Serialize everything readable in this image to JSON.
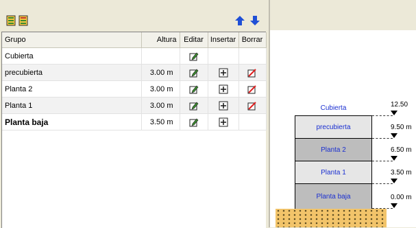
{
  "toolbar": {
    "icons": [
      "sheet-add-icon",
      "sheet-edit-icon",
      "arrow-up-icon",
      "arrow-down-icon"
    ]
  },
  "table": {
    "headers": {
      "grupo": "Grupo",
      "altura": "Altura",
      "editar": "Editar",
      "insertar": "Insertar",
      "borrar": "Borrar"
    },
    "rows": [
      {
        "grupo": "Cubierta",
        "altura": "",
        "edit": true,
        "insert": false,
        "delete": false
      },
      {
        "grupo": "precubierta",
        "altura": "3.00 m",
        "edit": true,
        "insert": true,
        "delete": true
      },
      {
        "grupo": "Planta 2",
        "altura": "3.00 m",
        "edit": true,
        "insert": true,
        "delete": true
      },
      {
        "grupo": "Planta 1",
        "altura": "3.00 m",
        "edit": true,
        "insert": true,
        "delete": true
      },
      {
        "grupo": "Planta baja",
        "altura": "3.50 m",
        "edit": true,
        "insert": true,
        "delete": false
      }
    ]
  },
  "diagram": {
    "levels": [
      {
        "name": "Cubierta",
        "elev": "12.50"
      },
      {
        "name": "precubierta",
        "elev": "9.50 m"
      },
      {
        "name": "Planta 2",
        "elev": "6.50 m"
      },
      {
        "name": "Planta 1",
        "elev": "3.50 m"
      },
      {
        "name": "Planta baja",
        "elev": "0.00 m"
      }
    ],
    "colors": {
      "floor_light": "#e6e6e6",
      "floor_dark": "#bdbdbd",
      "label": "#1a2fd0",
      "ground": "#f2c46a"
    }
  }
}
